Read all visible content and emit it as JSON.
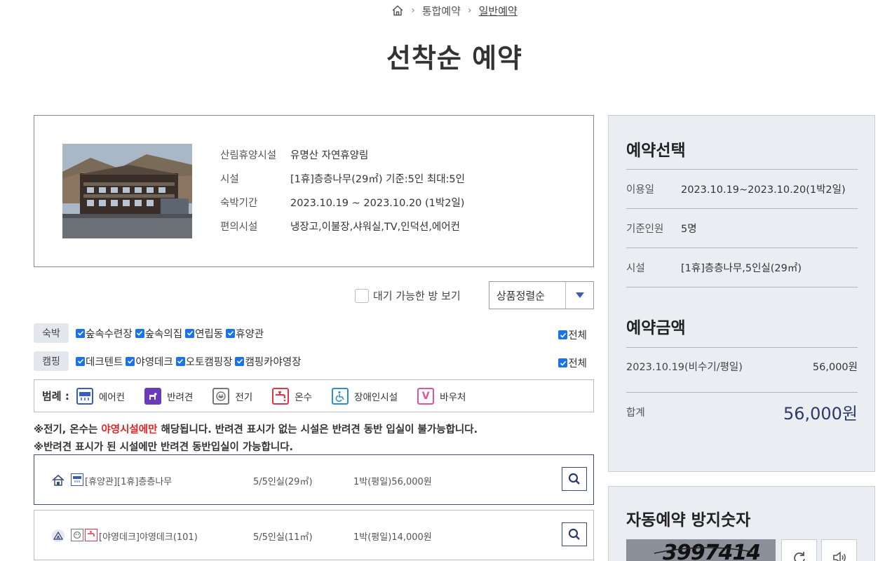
{
  "breadcrumb": {
    "item1": "통합예약",
    "item2": "일반예약"
  },
  "page_title": "선착순 예약",
  "info": {
    "rows": [
      {
        "k": "산림휴양시설",
        "v": "유명산 자연휴양림"
      },
      {
        "k": "시설",
        "v": "[1휴]층층나무(29㎡) 기준:5인 최대:5인"
      },
      {
        "k": "숙박기간",
        "v": "2023.10.19 ~ 2023.10.20 (1박2일)"
      },
      {
        "k": "편의시설",
        "v": "냉장고,이불장,샤워실,TV,인덕션,에어컨"
      }
    ]
  },
  "filter": {
    "wait_label": "대기 가능한 방 보기",
    "sort_label": "상품정렬순"
  },
  "categories": [
    {
      "tag": "숙박",
      "items": [
        "숲속수련장",
        "숲속의집",
        "연립동",
        "휴양관"
      ],
      "all": "전체"
    },
    {
      "tag": "캠핑",
      "items": [
        "데크텐트",
        "야영데크",
        "오토캠핑장",
        "캠핑카야영장"
      ],
      "all": "전체"
    }
  ],
  "legend": {
    "title": "범례 :",
    "items": [
      {
        "label": "에어컨",
        "icon": "aircon-icon",
        "color": "#3a5bbf"
      },
      {
        "label": "반려견",
        "icon": "pet-icon",
        "color": "#6a3ab8"
      },
      {
        "label": "전기",
        "icon": "electric-icon",
        "color": "#777777"
      },
      {
        "label": "온수",
        "icon": "hot-water-icon",
        "color": "#e0344b"
      },
      {
        "label": "장애인시설",
        "icon": "accessibility-icon",
        "color": "#2d8ecf"
      },
      {
        "label": "바우처",
        "icon": "voucher-icon",
        "color": "#e0559a"
      }
    ]
  },
  "notice": {
    "line1_a": "※전기, 온수는 ",
    "line1_red": "야영시설에만",
    "line1_b": " 해당됩니다. 반려견 표시가 없는 시설은 반려견 동반 입실이 불가능합니다.",
    "line2": "※반려견 표시가 된 시설에만 반려견 동반입실이 가능합니다."
  },
  "rooms": [
    {
      "name": "[휴양관][1휴]층층나무",
      "cap": "5/5인실(29㎡)",
      "price": "1박(평일)56,000원"
    },
    {
      "name": "[야영데크]야영데크(101)",
      "cap": "5/5인실(11㎡)",
      "price": "1박(평일)14,000원"
    }
  ],
  "summary": {
    "title": "예약선택",
    "rows": [
      {
        "k": "이용일",
        "v": "2023.10.19~2023.10.20(1박2일)"
      },
      {
        "k": "기준인원",
        "v": "5명"
      },
      {
        "k": "시설",
        "v": "[1휴]층층나무,5인실(29㎡)"
      }
    ],
    "price_title": "예약금액",
    "price_row": {
      "k": "2023.10.19(비수기/평일)",
      "v": "56,000원"
    },
    "total": {
      "k": "합계",
      "v": "56,000원"
    }
  },
  "captcha": {
    "title": "자동예약 방지숫자",
    "text": "3997414"
  }
}
